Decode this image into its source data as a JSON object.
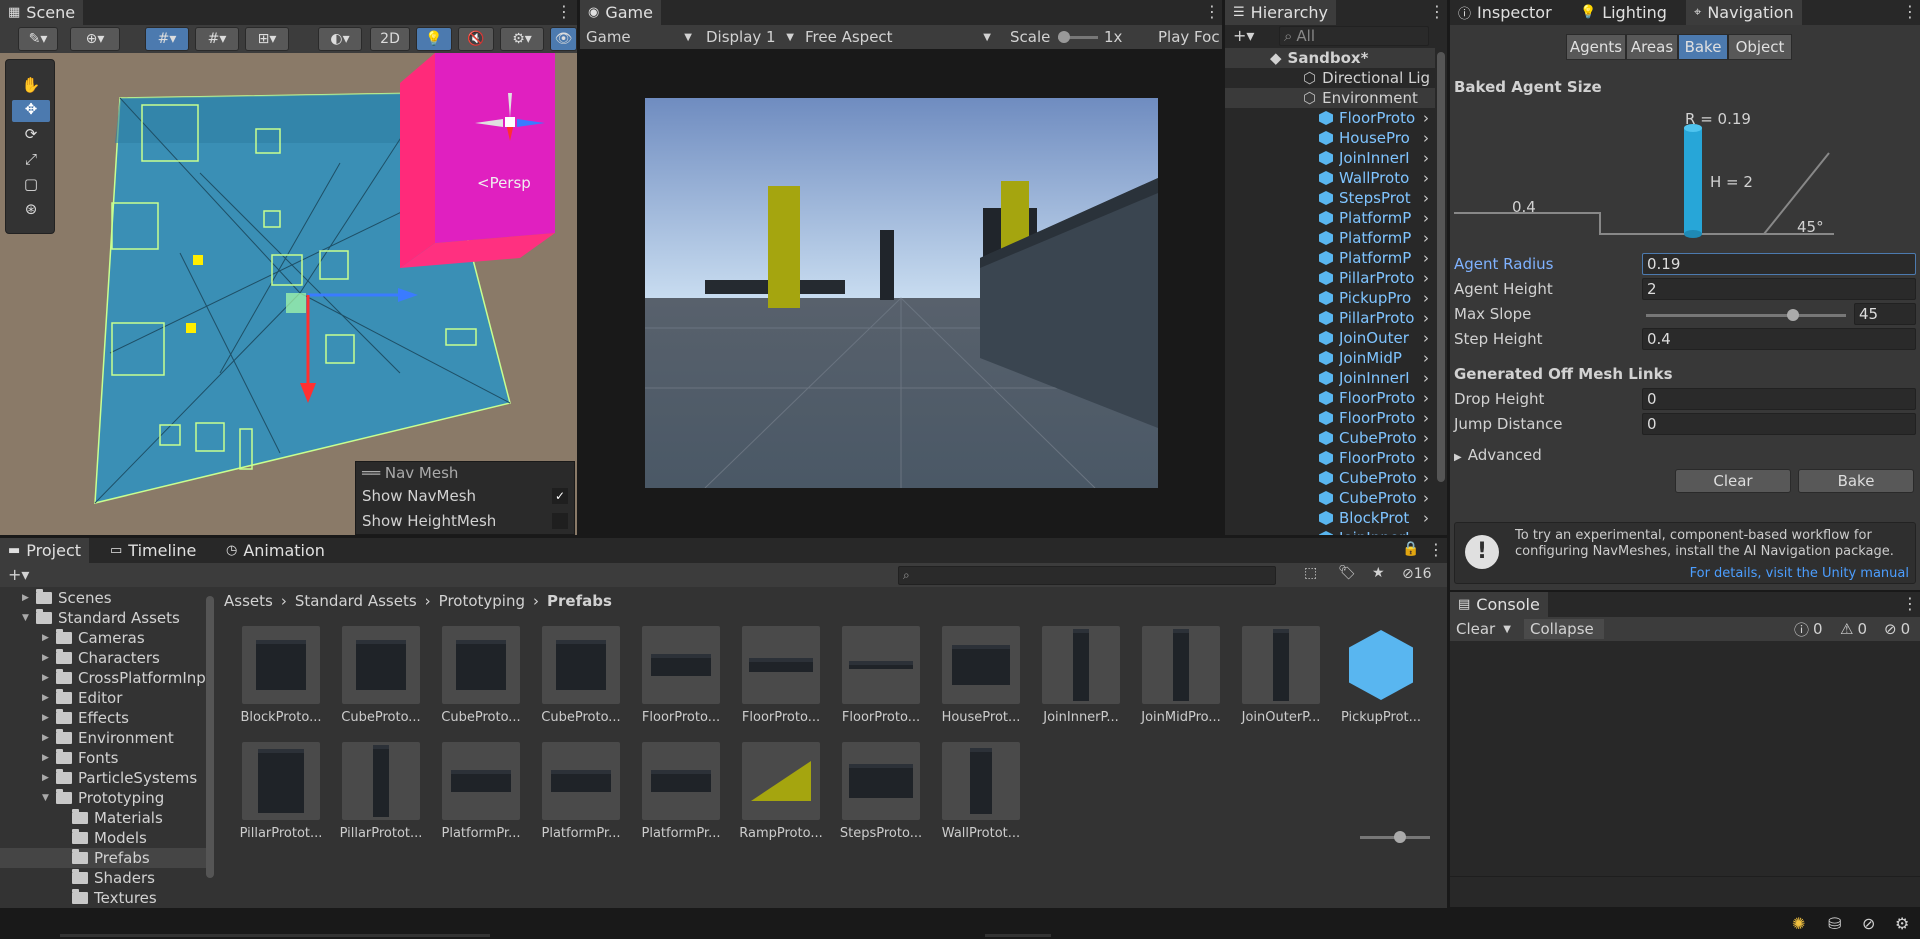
{
  "scene": {
    "tab": "Scene",
    "btn2d": "2D",
    "persp": "<Persp",
    "navmesh_overlay": {
      "title": "Nav Mesh",
      "show_navmesh": "Show NavMesh",
      "show_heightmesh": "Show HeightMesh",
      "navmesh_checked": true,
      "heightmesh_checked": false
    }
  },
  "game": {
    "tab": "Game",
    "mode": "Game",
    "display": "Display 1",
    "aspect": "Free Aspect",
    "scale_label": "Scale",
    "scale_value": "1x",
    "play_focused": "Play Foc"
  },
  "hierarchy": {
    "tab": "Hierarchy",
    "search_placeholder": "All",
    "scene": "Sandbox*",
    "items": [
      "Directional Lig",
      "Environment"
    ],
    "children": [
      "FloorProto",
      "HousePro",
      "JoinInnerI",
      "WallProto",
      "StepsProt",
      "PlatformP",
      "PlatformP",
      "PlatformP",
      "PillarProto",
      "PickupPro",
      "PillarProto",
      "JoinOuter",
      "JoinMidP",
      "JoinInnerI",
      "FloorProto",
      "FloorProto",
      "CubeProto",
      "FloorProto",
      "CubeProto",
      "CubeProto",
      "BlockProt",
      "JoinInnerI"
    ]
  },
  "inspector": {
    "tabs": [
      "Inspector",
      "Lighting",
      "Navigation"
    ],
    "segments": [
      "Agents",
      "Areas",
      "Bake",
      "Object"
    ],
    "baked_agent_size": "Baked Agent Size",
    "diagram": {
      "radius": "R = 0.19",
      "height": "H = 2",
      "step": "0.4",
      "slope": "45°"
    },
    "agent_radius_label": "Agent Radius",
    "agent_radius": "0.19",
    "agent_height_label": "Agent Height",
    "agent_height": "2",
    "max_slope_label": "Max Slope",
    "max_slope": "45",
    "max_slope_fraction": 0.75,
    "step_height_label": "Step Height",
    "step_height": "0.4",
    "off_mesh_title": "Generated Off Mesh Links",
    "drop_height_label": "Drop Height",
    "drop_height": "0",
    "jump_distance_label": "Jump Distance",
    "jump_distance": "0",
    "advanced": "Advanced",
    "clear": "Clear",
    "bake": "Bake",
    "info": "To try an experimental, component-based workflow for configuring NavMeshes, install the AI Navigation package.",
    "info_link": "For details, visit the Unity manual"
  },
  "console": {
    "tab": "Console",
    "clear": "Clear",
    "collapse": "Collapse",
    "info_count": "0",
    "warn_count": "0",
    "error_count": "0"
  },
  "project": {
    "tabs": [
      "Project",
      "Timeline",
      "Animation"
    ],
    "hidden_count": "16",
    "breadcrumb": [
      "Assets",
      "Standard Assets",
      "Prototyping",
      "Prefabs"
    ],
    "tree": [
      {
        "label": "Scenes",
        "depth": 1
      },
      {
        "label": "Standard Assets",
        "depth": 1
      },
      {
        "label": "Cameras",
        "depth": 2
      },
      {
        "label": "Characters",
        "depth": 2
      },
      {
        "label": "CrossPlatformInp",
        "depth": 2
      },
      {
        "label": "Editor",
        "depth": 2
      },
      {
        "label": "Effects",
        "depth": 2
      },
      {
        "label": "Environment",
        "depth": 2
      },
      {
        "label": "Fonts",
        "depth": 2
      },
      {
        "label": "ParticleSystems",
        "depth": 2
      },
      {
        "label": "Prototyping",
        "depth": 2
      },
      {
        "label": "Materials",
        "depth": 3
      },
      {
        "label": "Models",
        "depth": 3
      },
      {
        "label": "Prefabs",
        "depth": 3
      },
      {
        "label": "Shaders",
        "depth": 3
      },
      {
        "label": "Textures",
        "depth": 3
      }
    ],
    "assets": [
      "BlockProto...",
      "CubeProto...",
      "CubeProto...",
      "CubeProto...",
      "FloorProto...",
      "FloorProto...",
      "FloorProto...",
      "HouseProt...",
      "JoinInnerP...",
      "JoinMidPro...",
      "JoinOuterP...",
      "PickupProt...",
      "PillarProtot...",
      "PillarProtot...",
      "PlatformPr...",
      "PlatformPr...",
      "PlatformPr...",
      "RampProto...",
      "StepsProto...",
      "WallProtot..."
    ]
  },
  "colors": {
    "accent": "#4c7aaf",
    "link": "#4c9eff",
    "cube": "#59b6f0",
    "magenta": "#e020c0"
  }
}
